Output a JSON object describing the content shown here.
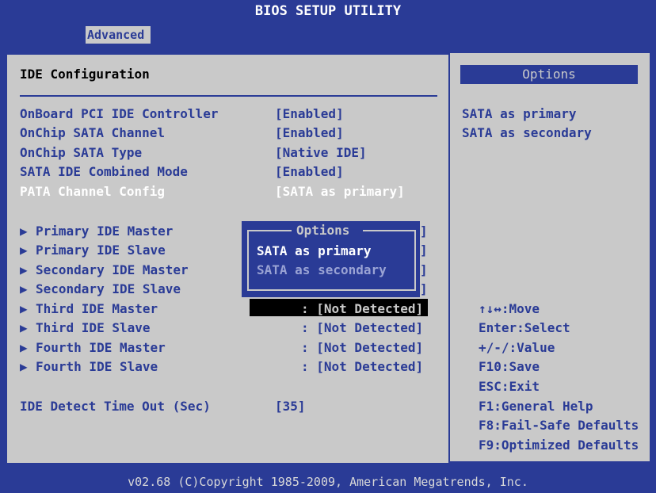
{
  "title": "BIOS SETUP UTILITY",
  "tabs": [
    {
      "label": "Advanced"
    }
  ],
  "section_title": "IDE Configuration",
  "settings": [
    {
      "label": "OnBoard PCI IDE Controller",
      "value": "[Enabled]"
    },
    {
      "label": "OnChip SATA Channel",
      "value": "[Enabled]"
    },
    {
      "label": "OnChip SATA Type",
      "value": "[Native IDE]"
    },
    {
      "label": "SATA IDE Combined Mode",
      "value": "[Enabled]"
    },
    {
      "label": "PATA Channel Config",
      "value": "[SATA as primary]"
    }
  ],
  "devices": [
    {
      "label": "Primary IDE Master",
      "value": ""
    },
    {
      "label": "Primary IDE Slave",
      "value": ""
    },
    {
      "label": "Secondary IDE Master",
      "value": ""
    },
    {
      "label": "Secondary IDE Slave",
      "value": ""
    },
    {
      "label": "Third IDE Master",
      "value": ": [Not Detected]"
    },
    {
      "label": "Third IDE Slave",
      "value": ": [Not Detected]"
    },
    {
      "label": "Fourth IDE Master",
      "value": ": [Not Detected]"
    },
    {
      "label": "Fourth IDE Slave",
      "value": ": [Not Detected]"
    }
  ],
  "timeout": {
    "label": "IDE Detect Time Out (Sec)",
    "value": "[35]"
  },
  "side": {
    "header": "Options",
    "lines": [
      "SATA as primary",
      "SATA as secondary"
    ],
    "help": [
      "↑↓↔:Move",
      "Enter:Select",
      "+/-/:Value",
      "F10:Save",
      "ESC:Exit",
      "F1:General Help",
      "F8:Fail-Safe Defaults",
      "F9:Optimized Defaults"
    ]
  },
  "popup": {
    "title": "Options",
    "options": [
      "SATA as primary",
      "SATA as secondary"
    ],
    "selected": "SATA as primary"
  },
  "footer": "v02.68 (C)Copyright 1985-2009, American Megatrends, Inc.",
  "colors": {
    "blue": "#2a3b96",
    "gray": "#c9c9c9",
    "highlight": "#ffffff"
  }
}
